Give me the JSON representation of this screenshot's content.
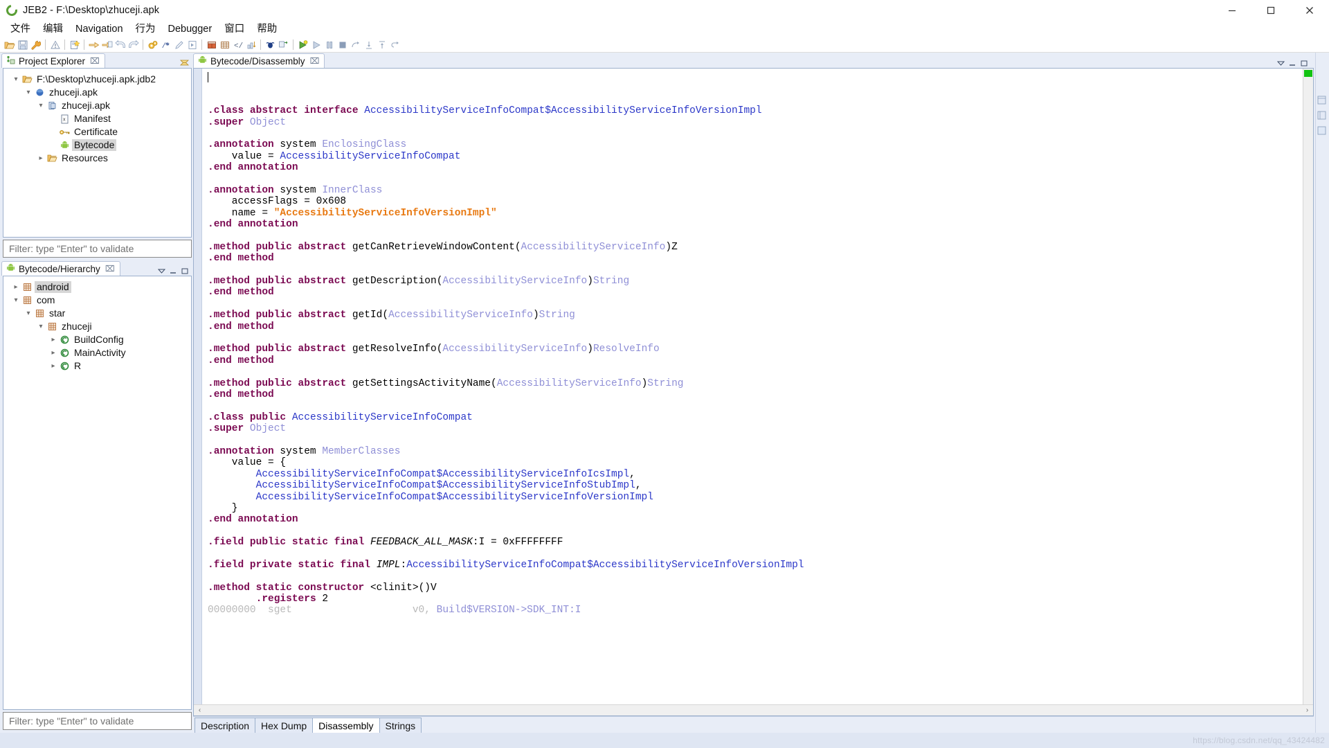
{
  "window": {
    "title": "JEB2 - F:\\Desktop\\zhuceji.apk",
    "app_icon": "jeb-logo-icon",
    "minimize_label": "—",
    "maximize_label": "❐",
    "close_label": "✕"
  },
  "menubar": {
    "items": [
      {
        "label": "文件"
      },
      {
        "label": "编辑"
      },
      {
        "label": "Navigation"
      },
      {
        "label": "行为"
      },
      {
        "label": "Debugger"
      },
      {
        "label": "窗口"
      },
      {
        "label": "帮助"
      }
    ]
  },
  "toolbar": {
    "groups": [
      [
        "open-folder-icon",
        "save-icon",
        "wrench-icon"
      ],
      [
        "warning-icon"
      ],
      [
        "new-document-icon"
      ],
      [
        "import-arrow-icon",
        "export-document-icon",
        "back-arrow-icon",
        "forward-arrow-icon"
      ],
      [
        "gears-icon",
        "comment-icon",
        "pencil-icon",
        "run-script-icon"
      ],
      [
        "table-icon",
        "grid-icon",
        "code-brackets-icon",
        "sort-icon"
      ],
      [
        "bug-icon",
        "debug-step-icon"
      ],
      [
        "debug-run-icon",
        "debug-play-icon",
        "debug-pause-icon",
        "debug-stop-icon",
        "step-over-icon",
        "step-into-icon",
        "step-return-icon",
        "step-out-icon"
      ]
    ]
  },
  "project_explorer": {
    "tab_label": "Project Explorer",
    "tab_icon": "project-explorer-icon",
    "close_icon": "⌧",
    "filter_placeholder": "Filter: type \"Enter\" to validate",
    "tree": [
      {
        "label": "F:\\Desktop\\zhuceji.apk.jdb2",
        "icon": "folder-open-icon",
        "depth": 0,
        "twisty": "expanded",
        "selected": false
      },
      {
        "label": "zhuceji.apk",
        "icon": "blue-sphere-icon",
        "depth": 1,
        "twisty": "expanded",
        "selected": false
      },
      {
        "label": "zhuceji.apk",
        "icon": "apk-unit-icon",
        "depth": 2,
        "twisty": "expanded",
        "selected": false
      },
      {
        "label": "Manifest",
        "icon": "xml-file-icon",
        "depth": 3,
        "twisty": "none",
        "selected": false
      },
      {
        "label": "Certificate",
        "icon": "key-icon",
        "depth": 3,
        "twisty": "none",
        "selected": false
      },
      {
        "label": "Bytecode",
        "icon": "android-icon",
        "depth": 3,
        "twisty": "none",
        "selected": true
      },
      {
        "label": "Resources",
        "icon": "folder-icon",
        "depth": 3,
        "twisty": "collapsed",
        "selected": false
      }
    ]
  },
  "hierarchy": {
    "tab_label": "Bytecode/Hierarchy",
    "tab_icon": "android-icon",
    "close_icon": "⌧",
    "filter_placeholder": "Filter: type \"Enter\" to validate",
    "tree": [
      {
        "label": "android",
        "icon": "package-icon",
        "depth": 0,
        "twisty": "collapsed",
        "selected": true
      },
      {
        "label": "com",
        "icon": "package-icon",
        "depth": 0,
        "twisty": "expanded",
        "selected": false
      },
      {
        "label": "star",
        "icon": "package-icon",
        "depth": 1,
        "twisty": "expanded",
        "selected": false
      },
      {
        "label": "zhuceji",
        "icon": "package-icon",
        "depth": 2,
        "twisty": "expanded",
        "selected": false
      },
      {
        "label": "BuildConfig",
        "icon": "class-icon",
        "depth": 3,
        "twisty": "collapsed",
        "selected": false
      },
      {
        "label": "MainActivity",
        "icon": "class-icon",
        "depth": 3,
        "twisty": "collapsed",
        "selected": false
      },
      {
        "label": "R",
        "icon": "class-icon",
        "depth": 3,
        "twisty": "collapsed",
        "selected": false
      }
    ]
  },
  "editor": {
    "tab_label": "Bytecode/Disassembly",
    "tab_icon": "android-icon",
    "close_icon": "⌧",
    "scroll_left_icon": "‹",
    "scroll_right_icon": "›",
    "bottom_tabs": [
      {
        "label": "Description",
        "active": false
      },
      {
        "label": "Hex Dump",
        "active": false
      },
      {
        "label": "Disassembly",
        "active": true
      },
      {
        "label": "Strings",
        "active": false
      }
    ],
    "code_lines": [
      [
        {
          "t": ".class ",
          "c": "kw"
        },
        {
          "t": "abstract ",
          "c": "kw"
        },
        {
          "t": "interface ",
          "c": "kw"
        },
        {
          "t": "AccessibilityServiceInfoCompat$AccessibilityServiceInfoVersionImpl",
          "c": "cls"
        }
      ],
      [
        {
          "t": ".super ",
          "c": "kw"
        },
        {
          "t": "Object",
          "c": "typ"
        }
      ],
      [
        {
          "t": "",
          "c": "plain"
        }
      ],
      [
        {
          "t": ".annotation ",
          "c": "kw"
        },
        {
          "t": "system ",
          "c": "plain"
        },
        {
          "t": "EnclosingClass",
          "c": "typ"
        }
      ],
      [
        {
          "t": "    value = ",
          "c": "plain"
        },
        {
          "t": "AccessibilityServiceInfoCompat",
          "c": "cls"
        }
      ],
      [
        {
          "t": ".end annotation",
          "c": "kw"
        }
      ],
      [
        {
          "t": "",
          "c": "plain"
        }
      ],
      [
        {
          "t": ".annotation ",
          "c": "kw"
        },
        {
          "t": "system ",
          "c": "plain"
        },
        {
          "t": "InnerClass",
          "c": "typ"
        }
      ],
      [
        {
          "t": "    accessFlags = 0x608",
          "c": "plain"
        }
      ],
      [
        {
          "t": "    name = ",
          "c": "plain"
        },
        {
          "t": "\"AccessibilityServiceInfoVersionImpl\"",
          "c": "str"
        }
      ],
      [
        {
          "t": ".end annotation",
          "c": "kw"
        }
      ],
      [
        {
          "t": "",
          "c": "plain"
        }
      ],
      [
        {
          "t": ".method ",
          "c": "kw"
        },
        {
          "t": "public ",
          "c": "kw"
        },
        {
          "t": "abstract ",
          "c": "kw"
        },
        {
          "t": "getCanRetrieveWindowContent(",
          "c": "plain"
        },
        {
          "t": "AccessibilityServiceInfo",
          "c": "typ"
        },
        {
          "t": ")",
          "c": "plain"
        },
        {
          "t": "Z",
          "c": "plain"
        }
      ],
      [
        {
          "t": ".end method",
          "c": "kw"
        }
      ],
      [
        {
          "t": "",
          "c": "plain"
        }
      ],
      [
        {
          "t": ".method ",
          "c": "kw"
        },
        {
          "t": "public ",
          "c": "kw"
        },
        {
          "t": "abstract ",
          "c": "kw"
        },
        {
          "t": "getDescription(",
          "c": "plain"
        },
        {
          "t": "AccessibilityServiceInfo",
          "c": "typ"
        },
        {
          "t": ")",
          "c": "plain"
        },
        {
          "t": "String",
          "c": "typ"
        }
      ],
      [
        {
          "t": ".end method",
          "c": "kw"
        }
      ],
      [
        {
          "t": "",
          "c": "plain"
        }
      ],
      [
        {
          "t": ".method ",
          "c": "kw"
        },
        {
          "t": "public ",
          "c": "kw"
        },
        {
          "t": "abstract ",
          "c": "kw"
        },
        {
          "t": "getId(",
          "c": "plain"
        },
        {
          "t": "AccessibilityServiceInfo",
          "c": "typ"
        },
        {
          "t": ")",
          "c": "plain"
        },
        {
          "t": "String",
          "c": "typ"
        }
      ],
      [
        {
          "t": ".end method",
          "c": "kw"
        }
      ],
      [
        {
          "t": "",
          "c": "plain"
        }
      ],
      [
        {
          "t": ".method ",
          "c": "kw"
        },
        {
          "t": "public ",
          "c": "kw"
        },
        {
          "t": "abstract ",
          "c": "kw"
        },
        {
          "t": "getResolveInfo(",
          "c": "plain"
        },
        {
          "t": "AccessibilityServiceInfo",
          "c": "typ"
        },
        {
          "t": ")",
          "c": "plain"
        },
        {
          "t": "ResolveInfo",
          "c": "typ"
        }
      ],
      [
        {
          "t": ".end method",
          "c": "kw"
        }
      ],
      [
        {
          "t": "",
          "c": "plain"
        }
      ],
      [
        {
          "t": ".method ",
          "c": "kw"
        },
        {
          "t": "public ",
          "c": "kw"
        },
        {
          "t": "abstract ",
          "c": "kw"
        },
        {
          "t": "getSettingsActivityName(",
          "c": "plain"
        },
        {
          "t": "AccessibilityServiceInfo",
          "c": "typ"
        },
        {
          "t": ")",
          "c": "plain"
        },
        {
          "t": "String",
          "c": "typ"
        }
      ],
      [
        {
          "t": ".end method",
          "c": "kw"
        }
      ],
      [
        {
          "t": "",
          "c": "plain"
        }
      ],
      [
        {
          "t": ".class ",
          "c": "kw"
        },
        {
          "t": "public ",
          "c": "kw"
        },
        {
          "t": "AccessibilityServiceInfoCompat",
          "c": "cls"
        }
      ],
      [
        {
          "t": ".super ",
          "c": "kw"
        },
        {
          "t": "Object",
          "c": "typ"
        }
      ],
      [
        {
          "t": "",
          "c": "plain"
        }
      ],
      [
        {
          "t": ".annotation ",
          "c": "kw"
        },
        {
          "t": "system ",
          "c": "plain"
        },
        {
          "t": "MemberClasses",
          "c": "typ"
        }
      ],
      [
        {
          "t": "    value = {",
          "c": "plain"
        }
      ],
      [
        {
          "t": "        ",
          "c": "plain"
        },
        {
          "t": "AccessibilityServiceInfoCompat$AccessibilityServiceInfoIcsImpl",
          "c": "cls"
        },
        {
          "t": ",",
          "c": "plain"
        }
      ],
      [
        {
          "t": "        ",
          "c": "plain"
        },
        {
          "t": "AccessibilityServiceInfoCompat$AccessibilityServiceInfoStubImpl",
          "c": "cls"
        },
        {
          "t": ",",
          "c": "plain"
        }
      ],
      [
        {
          "t": "        ",
          "c": "plain"
        },
        {
          "t": "AccessibilityServiceInfoCompat$AccessibilityServiceInfoVersionImpl",
          "c": "cls"
        }
      ],
      [
        {
          "t": "    }",
          "c": "plain"
        }
      ],
      [
        {
          "t": ".end annotation",
          "c": "kw"
        }
      ],
      [
        {
          "t": "",
          "c": "plain"
        }
      ],
      [
        {
          "t": ".field ",
          "c": "kw"
        },
        {
          "t": "public ",
          "c": "kw"
        },
        {
          "t": "static ",
          "c": "kw"
        },
        {
          "t": "final ",
          "c": "kw"
        },
        {
          "t": "FEEDBACK_ALL_MASK",
          "c": "fld"
        },
        {
          "t": ":I = 0xFFFFFFFF",
          "c": "plain"
        }
      ],
      [
        {
          "t": "",
          "c": "plain"
        }
      ],
      [
        {
          "t": ".field ",
          "c": "kw"
        },
        {
          "t": "private ",
          "c": "kw"
        },
        {
          "t": "static ",
          "c": "kw"
        },
        {
          "t": "final ",
          "c": "kw"
        },
        {
          "t": "IMPL",
          "c": "fld"
        },
        {
          "t": ":",
          "c": "plain"
        },
        {
          "t": "AccessibilityServiceInfoCompat$AccessibilityServiceInfoVersionImpl",
          "c": "cls"
        }
      ],
      [
        {
          "t": "",
          "c": "plain"
        }
      ],
      [
        {
          "t": ".method ",
          "c": "kw"
        },
        {
          "t": "static ",
          "c": "kw"
        },
        {
          "t": "constructor ",
          "c": "kw"
        },
        {
          "t": "<clinit>()V",
          "c": "plain"
        }
      ],
      [
        {
          "t": "        ",
          "c": "plain"
        },
        {
          "t": ".registers ",
          "c": "kw"
        },
        {
          "t": "2",
          "c": "plain"
        }
      ],
      [
        {
          "t": "00000000  sget                    v0, ",
          "c": "addr"
        },
        {
          "t": "Build$VERSION->SDK_INT:I",
          "c": "typ"
        }
      ]
    ]
  },
  "statusbar": {
    "watermark": "https://blog.csdn.net/qq_43424482"
  }
}
